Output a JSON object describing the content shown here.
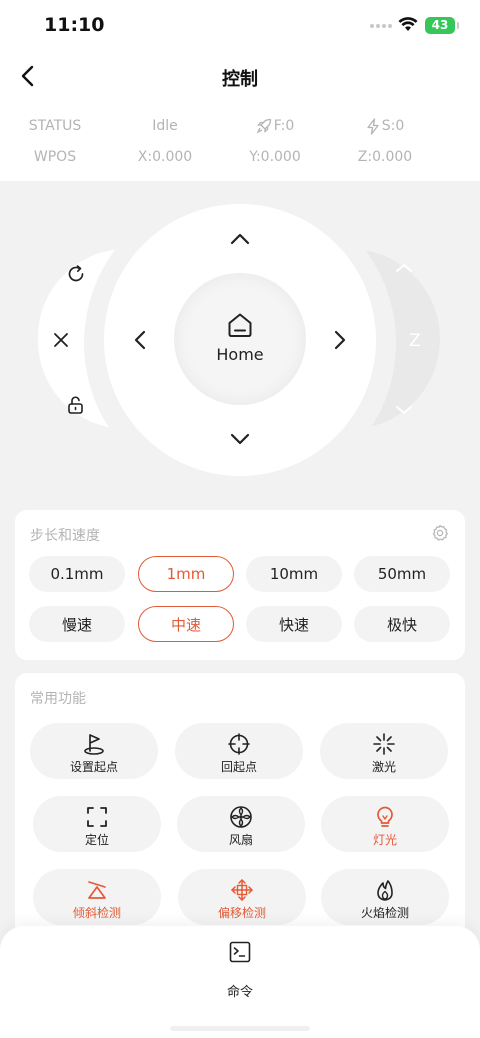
{
  "status_bar": {
    "time": "11:10",
    "battery": "43"
  },
  "nav": {
    "title": "控制"
  },
  "machine_status": {
    "status_label": "STATUS",
    "state": "Idle",
    "feed": "F:0",
    "spindle": "S:0",
    "wpos_label": "WPOS",
    "x": "X:0.000",
    "y": "Y:0.000",
    "z": "Z:0.000"
  },
  "jog": {
    "home_label": "Home",
    "z_label": "Z"
  },
  "step_speed": {
    "title": "步长和速度",
    "steps": [
      "0.1mm",
      "1mm",
      "10mm",
      "50mm"
    ],
    "selected_step": "1mm",
    "speeds": [
      "慢速",
      "中速",
      "快速",
      "极快"
    ],
    "selected_speed": "中速"
  },
  "functions": {
    "title": "常用功能",
    "items": [
      {
        "label": "设置起点",
        "icon": "flag-icon"
      },
      {
        "label": "回起点",
        "icon": "crosshair-icon"
      },
      {
        "label": "激光",
        "icon": "laser-icon"
      },
      {
        "label": "定位",
        "icon": "frame-icon"
      },
      {
        "label": "风扇",
        "icon": "fan-icon"
      },
      {
        "label": "灯光",
        "icon": "bulb-icon"
      },
      {
        "label": "倾斜检测",
        "icon": "tilt-icon"
      },
      {
        "label": "偏移检测",
        "icon": "move-icon"
      },
      {
        "label": "火焰检测",
        "icon": "flame-icon"
      }
    ]
  },
  "command": {
    "label": "命令"
  },
  "colors": {
    "accent": "#e35a36",
    "muted": "#b4b4b4",
    "background": "#f2f2f2"
  }
}
